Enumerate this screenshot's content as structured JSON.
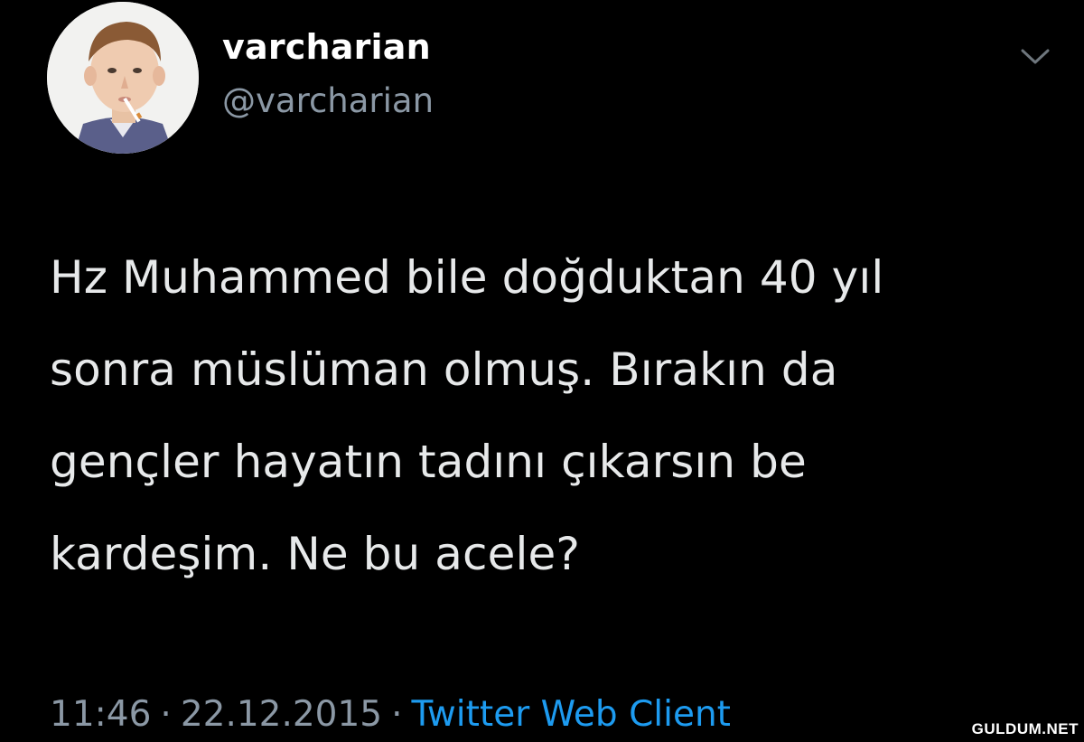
{
  "tweet": {
    "author": {
      "display_name": "varcharian",
      "handle": "@varcharian",
      "avatar": "profile-photo-child-with-cigarette"
    },
    "menu_icon": "chevron-down-icon",
    "text_lines": [
      "Hz Muhammed bile doğduktan 40 yıl",
      "sonra müslüman olmuş. Bırakın da",
      "gençler hayatın tadını çıkarsın be",
      "kardeşim. Ne bu acele?"
    ],
    "time": "11:46",
    "date": "22.12.2015",
    "separator": "·",
    "source": "Twitter Web Client"
  },
  "watermark": "GULDUM.NET",
  "colors": {
    "background": "#000000",
    "text": "#e7e9ea",
    "secondary": "#8b98a5",
    "link": "#1d9bf0"
  }
}
